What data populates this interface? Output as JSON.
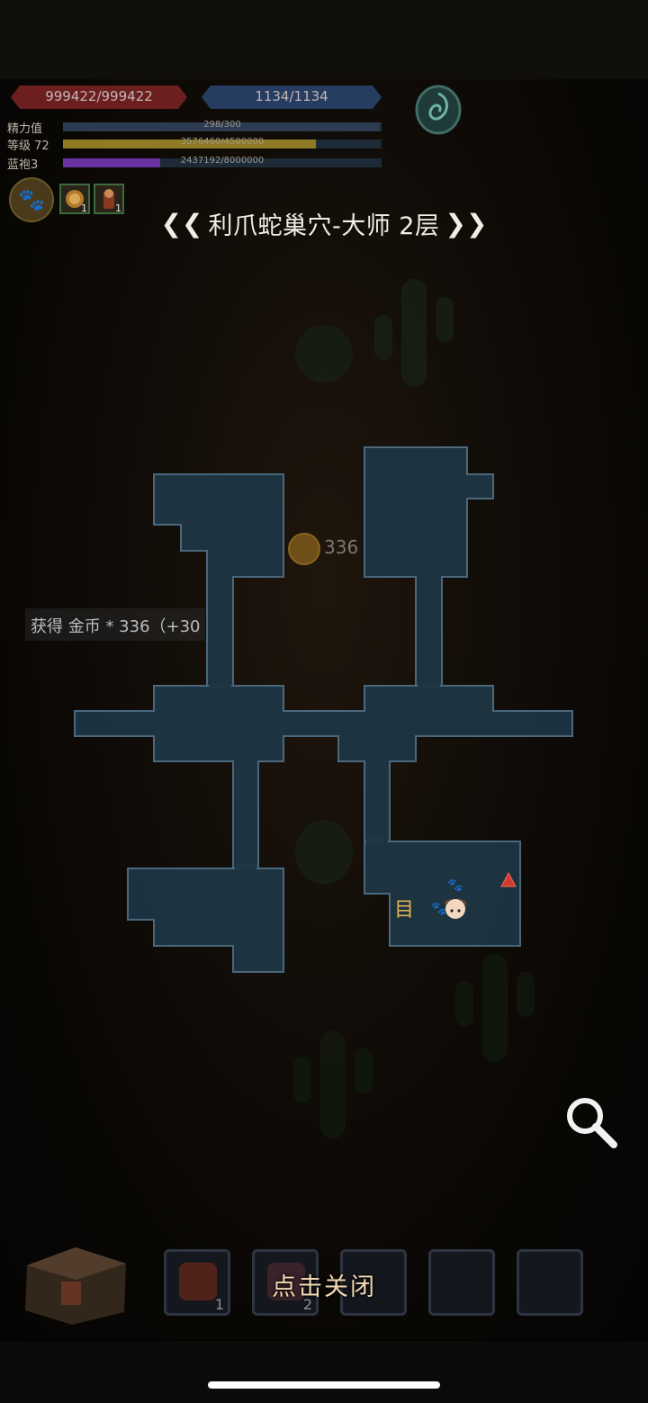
{
  "hud": {
    "hp": "999422/999422",
    "mp": "1134/1134",
    "stats": [
      {
        "label": "精力值",
        "value": "298/300",
        "fill": 0.993,
        "color": "#2c3b52"
      },
      {
        "label": "等级 72",
        "value": "3576460/4500000",
        "fill": 0.795,
        "color": "#8f7a26"
      },
      {
        "label": "蓝袍3",
        "value": "2437192/8000000",
        "fill": 0.305,
        "color": "#6a31a0"
      }
    ],
    "buffs": [
      {
        "icon": "lion-buff-icon",
        "count": "1"
      },
      {
        "icon": "warrior-buff-icon",
        "count": "1"
      }
    ]
  },
  "title": "利爪蛇巢穴-大师 2层",
  "coin_popup": "336",
  "toast": "获得 金币 * 336（+30",
  "map": {
    "ladder_glyph": "目",
    "paw_glyph": "🐾",
    "colors": {
      "room": "#1f3645",
      "outline": "#4e6f86",
      "marker": "#d13a30"
    }
  },
  "inventory": {
    "slots": [
      {
        "name": "slot-1",
        "count": "1",
        "item": "potion"
      },
      {
        "name": "slot-2",
        "count": "2",
        "item": "bomb"
      },
      {
        "name": "slot-3",
        "count": "",
        "item": ""
      },
      {
        "name": "slot-4",
        "count": "",
        "item": ""
      },
      {
        "name": "slot-5",
        "count": "",
        "item": ""
      }
    ]
  },
  "close_hint": "点击关闭"
}
